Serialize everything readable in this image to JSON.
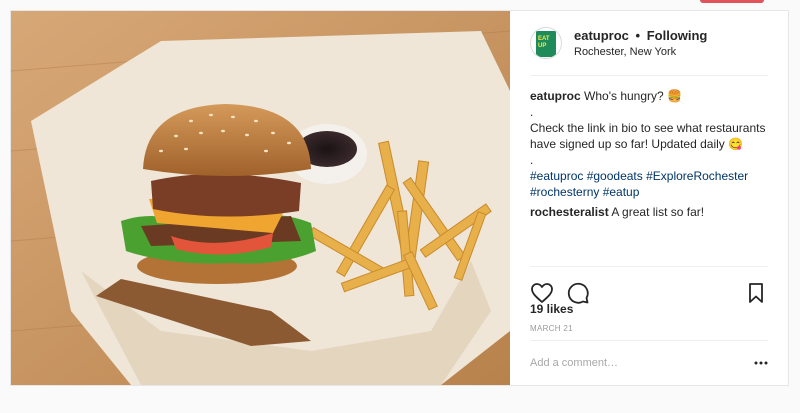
{
  "post": {
    "username": "eatuproc",
    "follow_status": "Following",
    "separator": "•",
    "location": "Rochester, New York",
    "avatar_text": "EAT UP",
    "caption": {
      "username": "eatuproc",
      "line1": "Who's hungry? 🍔",
      "dot1": ".",
      "line2": "Check the link in bio to see what restaurants have signed up so far! Updated daily 😋",
      "dot2": ".",
      "hashtags": "#eatuproc #goodeats #ExploreRochester #rochesterny #eatup"
    },
    "comment": {
      "username": "rochesteralist",
      "text": "A great list so far!"
    },
    "likes": "19 likes",
    "date": "MARCH 21",
    "comment_placeholder": "Add a comment…"
  },
  "icons": {
    "like": "heart-icon",
    "comment": "comment-bubble-icon",
    "save": "bookmark-icon",
    "more": "more-options-icon"
  },
  "colors": {
    "accent": "#e0535d",
    "hashtag": "#003569",
    "muted": "#999999"
  }
}
